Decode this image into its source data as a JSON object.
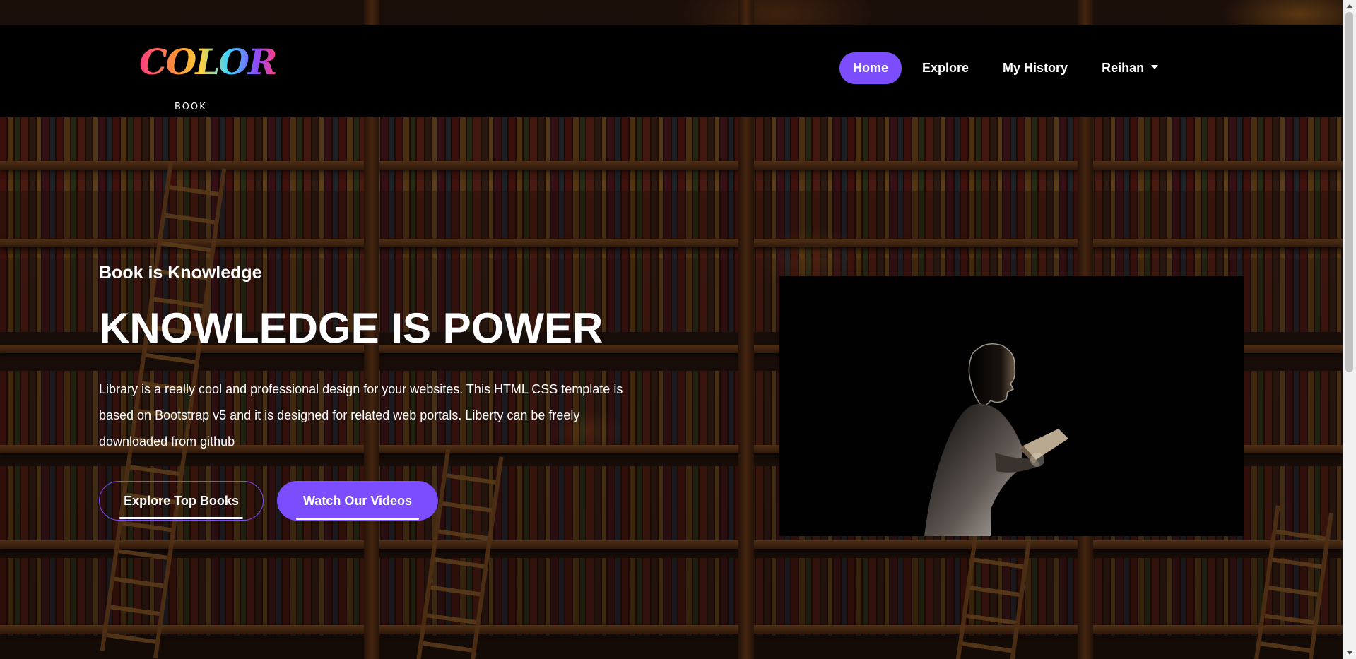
{
  "brand": {
    "logo_word": "COLOR",
    "logo_sub": "BOOK"
  },
  "nav": {
    "items": [
      {
        "label": "Home",
        "active": true
      },
      {
        "label": "Explore",
        "active": false
      },
      {
        "label": "My History",
        "active": false
      },
      {
        "label": "Reihan",
        "active": false,
        "dropdown": true
      }
    ]
  },
  "hero": {
    "subtitle": "Book is Knowledge",
    "title": "KNOWLEDGE IS POWER",
    "description": "Library is a really cool and professional design for your websites. This HTML CSS template is based on Bootstrap v5 and it is designed for related web portals. Liberty can be freely downloaded from github",
    "primary_button": "Explore Top Books",
    "secondary_button": "Watch Our Videos"
  },
  "colors": {
    "accent": "#7b4dff",
    "navbar_bg": "#000000",
    "text": "#ffffff"
  },
  "icons": {
    "dropdown": "caret-down-icon",
    "logo": "color-book-logo",
    "media": "person-reading-book-image"
  }
}
